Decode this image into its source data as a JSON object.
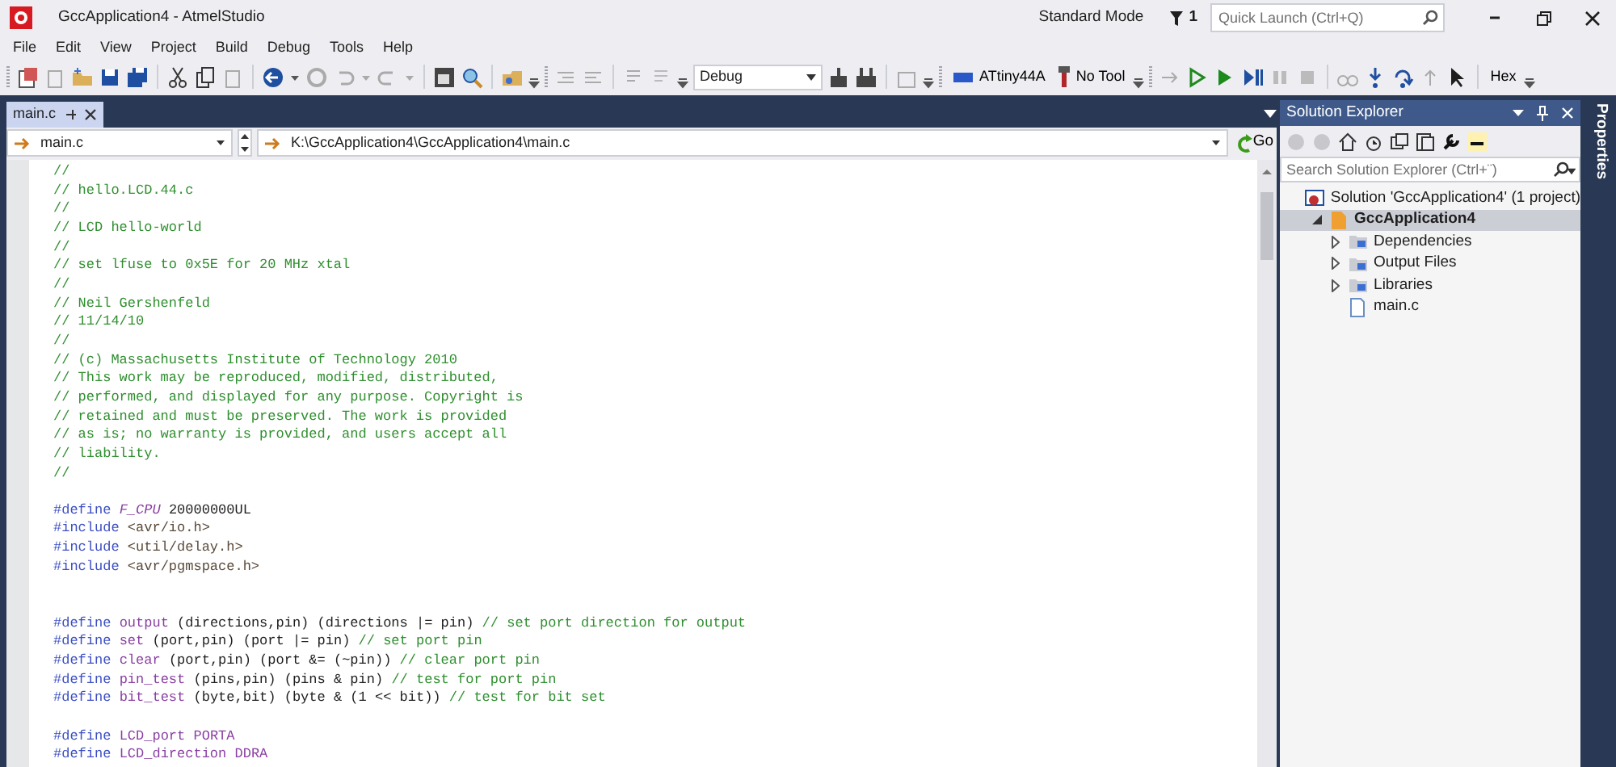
{
  "window": {
    "title": "GccApplication4 - AtmelStudio",
    "mode": "Standard Mode",
    "notifications": "1",
    "quick_launch": {
      "placeholder": "Quick Launch (Ctrl+Q)"
    }
  },
  "menu": [
    "File",
    "Edit",
    "View",
    "Project",
    "Build",
    "Debug",
    "Tools",
    "Help"
  ],
  "toolbar": {
    "configuration": "Debug",
    "device": "ATtiny44A",
    "tool": "No Tool",
    "display_format": "Hex"
  },
  "tabs": [
    {
      "label": "main.c",
      "selected": true
    }
  ],
  "navigation": {
    "scope": "main.c",
    "file_path": "K:\\GccApplication4\\GccApplication4\\main.c",
    "go": "Go"
  },
  "code": [
    {
      "kind": "line",
      "tokens": [
        {
          "kind": "comment",
          "text": "//"
        }
      ]
    },
    {
      "kind": "line",
      "tokens": [
        {
          "kind": "comment",
          "text": "// hello.LCD.44.c"
        }
      ]
    },
    {
      "kind": "line",
      "tokens": [
        {
          "kind": "comment",
          "text": "//"
        }
      ]
    },
    {
      "kind": "line",
      "tokens": [
        {
          "kind": "comment",
          "text": "// LCD hello-world"
        }
      ]
    },
    {
      "kind": "line",
      "tokens": [
        {
          "kind": "comment",
          "text": "//"
        }
      ]
    },
    {
      "kind": "line",
      "tokens": [
        {
          "kind": "comment",
          "text": "// set lfuse to 0x5E for 20 MHz xtal"
        }
      ]
    },
    {
      "kind": "line",
      "tokens": [
        {
          "kind": "comment",
          "text": "//"
        }
      ]
    },
    {
      "kind": "line",
      "tokens": [
        {
          "kind": "comment",
          "text": "// Neil Gershenfeld"
        }
      ]
    },
    {
      "kind": "line",
      "tokens": [
        {
          "kind": "comment",
          "text": "// 11/14/10"
        }
      ]
    },
    {
      "kind": "line",
      "tokens": [
        {
          "kind": "comment",
          "text": "//"
        }
      ]
    },
    {
      "kind": "line",
      "tokens": [
        {
          "kind": "comment",
          "text": "// (c) Massachusetts Institute of Technology 2010"
        }
      ]
    },
    {
      "kind": "line",
      "tokens": [
        {
          "kind": "comment",
          "text": "// This work may be reproduced, modified, distributed,"
        }
      ]
    },
    {
      "kind": "line",
      "tokens": [
        {
          "kind": "comment",
          "text": "// performed, and displayed for any purpose. Copyright is"
        }
      ]
    },
    {
      "kind": "line",
      "tokens": [
        {
          "kind": "comment",
          "text": "// retained and must be preserved. The work is provided"
        }
      ]
    },
    {
      "kind": "line",
      "tokens": [
        {
          "kind": "comment",
          "text": "// as is; no warranty is provided, and users accept all"
        }
      ]
    },
    {
      "kind": "line",
      "tokens": [
        {
          "kind": "comment",
          "text": "// liability."
        }
      ]
    },
    {
      "kind": "line",
      "tokens": [
        {
          "kind": "comment",
          "text": "//"
        }
      ]
    },
    {
      "kind": "blank"
    },
    {
      "kind": "line",
      "tokens": [
        {
          "kind": "directive",
          "text": "#define"
        },
        {
          "kind": "predefined",
          "text": "F_CPU"
        },
        {
          "kind": "number",
          "text": "20000000UL"
        }
      ]
    },
    {
      "kind": "line",
      "tokens": [
        {
          "kind": "directive",
          "text": "#include"
        },
        {
          "kind": "path",
          "text": "<avr/io.h>"
        }
      ]
    },
    {
      "kind": "line",
      "tokens": [
        {
          "kind": "directive",
          "text": "#include"
        },
        {
          "kind": "path",
          "text": "<util/delay.h>"
        }
      ]
    },
    {
      "kind": "line",
      "tokens": [
        {
          "kind": "directive",
          "text": "#include"
        },
        {
          "kind": "path",
          "text": "<avr/pgmspace.h>"
        }
      ]
    },
    {
      "kind": "blank"
    },
    {
      "kind": "blank"
    },
    {
      "kind": "line",
      "tokens": [
        {
          "kind": "directive",
          "text": "#define"
        },
        {
          "kind": "macro",
          "text": "output"
        },
        {
          "kind": "plain",
          "text": "(directions,pin) (directions |= pin)"
        },
        {
          "kind": "comment",
          "text": "// set port direction for output"
        }
      ]
    },
    {
      "kind": "line",
      "tokens": [
        {
          "kind": "directive",
          "text": "#define"
        },
        {
          "kind": "macro",
          "text": "set"
        },
        {
          "kind": "plain",
          "text": "(port,pin) (port |= pin)"
        },
        {
          "kind": "comment",
          "text": "// set port pin"
        }
      ]
    },
    {
      "kind": "line",
      "tokens": [
        {
          "kind": "directive",
          "text": "#define"
        },
        {
          "kind": "macro",
          "text": "clear"
        },
        {
          "kind": "plain",
          "text": "(port,pin) (port &= (~pin))"
        },
        {
          "kind": "comment",
          "text": "// clear port pin"
        }
      ]
    },
    {
      "kind": "line",
      "tokens": [
        {
          "kind": "directive",
          "text": "#define"
        },
        {
          "kind": "macro",
          "text": "pin_test"
        },
        {
          "kind": "plain",
          "text": "(pins,pin) (pins & pin)"
        },
        {
          "kind": "comment",
          "text": "// test for port pin"
        }
      ]
    },
    {
      "kind": "line",
      "tokens": [
        {
          "kind": "directive",
          "text": "#define"
        },
        {
          "kind": "macro",
          "text": "bit_test"
        },
        {
          "kind": "plain",
          "text": "(byte,bit) (byte & (1 << bit))"
        },
        {
          "kind": "comment",
          "text": "// test for bit set"
        }
      ]
    },
    {
      "kind": "blank"
    },
    {
      "kind": "line",
      "tokens": [
        {
          "kind": "directive",
          "text": "#define"
        },
        {
          "kind": "macro",
          "text": "LCD_port"
        },
        {
          "kind": "macro",
          "text": "PORTA"
        }
      ]
    },
    {
      "kind": "line",
      "tokens": [
        {
          "kind": "directive",
          "text": "#define"
        },
        {
          "kind": "macro",
          "text": "LCD_direction"
        },
        {
          "kind": "macro",
          "text": "DDRA"
        }
      ]
    }
  ],
  "solution_explorer": {
    "title": "Solution Explorer",
    "search": {
      "placeholder": "Search Solution Explorer (Ctrl+¨)"
    },
    "tree": [
      {
        "kind": "solution",
        "label": "Solution 'GccApplication4' (1 project)",
        "selected": false,
        "children": [
          {
            "kind": "project",
            "label": "GccApplication4",
            "expanded": true,
            "selected": true,
            "children": [
              {
                "kind": "folder",
                "label": "Dependencies",
                "expanded": false,
                "selected": false
              },
              {
                "kind": "folder",
                "label": "Output Files",
                "expanded": false,
                "selected": false
              },
              {
                "kind": "folder",
                "label": "Libraries",
                "expanded": false,
                "selected": false
              },
              {
                "kind": "file",
                "label": "main.c",
                "selected": false
              }
            ]
          }
        ]
      }
    ]
  },
  "side_tab": "Properties"
}
